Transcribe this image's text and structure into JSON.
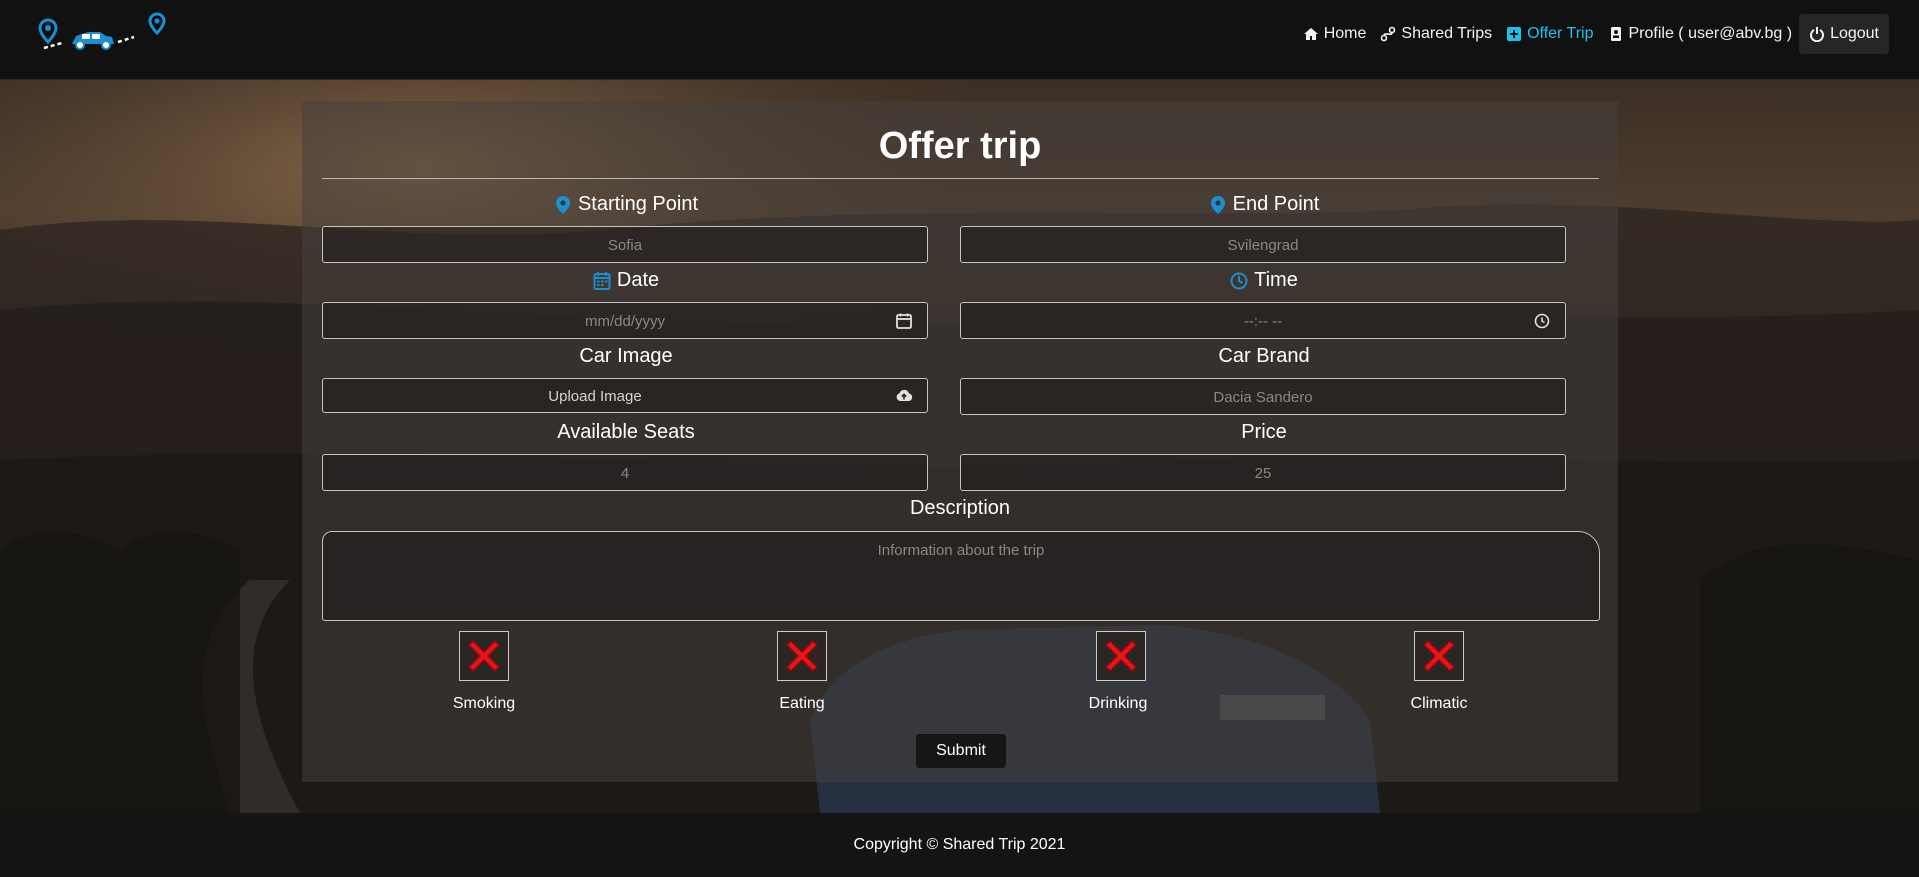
{
  "nav": {
    "links": [
      {
        "label": "Home",
        "icon": "home-icon"
      },
      {
        "label": "Shared Trips",
        "icon": "route-icon"
      },
      {
        "label": "Offer Trip",
        "icon": "plus-square-icon",
        "active": true
      },
      {
        "label": "Profile ( user@abv.bg )",
        "icon": "id-badge-icon"
      },
      {
        "label": "Logout",
        "icon": "power-icon"
      }
    ],
    "active_color": "#1ec0f0"
  },
  "form": {
    "title": "Offer trip",
    "starting_point": {
      "label": "Starting Point",
      "placeholder": "Sofia",
      "icon": "map-marker-icon"
    },
    "end_point": {
      "label": "End Point",
      "placeholder": "Svilengrad",
      "icon": "map-marker-icon"
    },
    "date": {
      "label": "Date",
      "placeholder": "mm/dd/yyyy",
      "icon": "calendar-icon"
    },
    "time": {
      "label": "Time",
      "placeholder": "--:-- --",
      "icon": "clock-icon"
    },
    "car_image": {
      "label": "Car Image",
      "button": "Upload Image",
      "icon": "cloud-upload-icon"
    },
    "car_brand": {
      "label": "Car Brand",
      "placeholder": "Dacia Sandero"
    },
    "seats": {
      "label": "Available Seats",
      "placeholder": "4"
    },
    "price": {
      "label": "Price",
      "placeholder": "25"
    },
    "description": {
      "label": "Description",
      "placeholder": "Information about the trip"
    },
    "options": [
      {
        "label": "Smoking",
        "icon": "red-x-icon"
      },
      {
        "label": "Eating",
        "icon": "red-x-icon"
      },
      {
        "label": "Drinking",
        "icon": "red-x-icon"
      },
      {
        "label": "Climatic",
        "icon": "red-x-icon"
      }
    ],
    "submit": "Submit"
  },
  "footer": {
    "text": "Copyright © Shared Trip 2021"
  },
  "colors": {
    "accent_blue": "#1a8fd1",
    "navbar": "#111111",
    "panel": "rgba(70,64,60,0.55)"
  }
}
